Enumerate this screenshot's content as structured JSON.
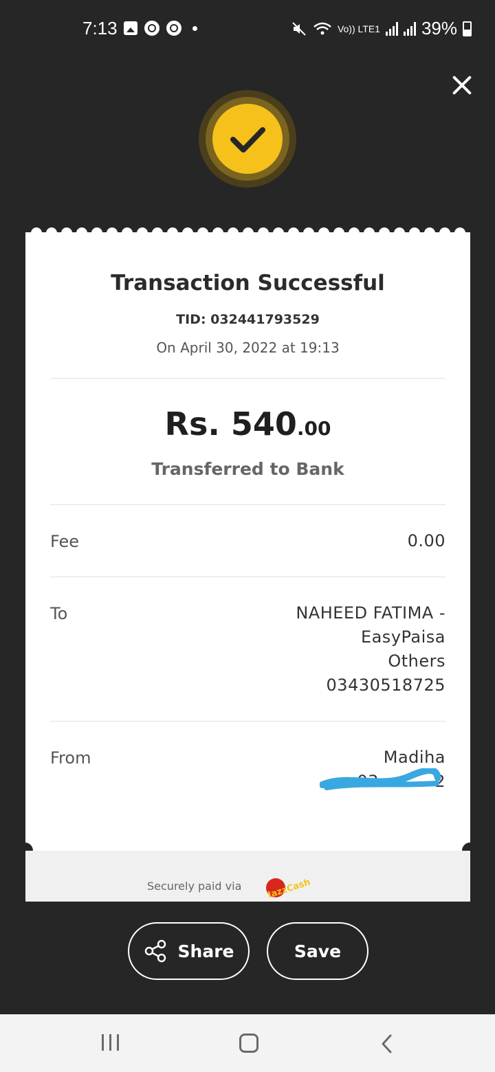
{
  "status_bar": {
    "time": "7:13",
    "network_label": "Vo)) LTE1",
    "battery": "39%",
    "icons": [
      "image-icon",
      "chrome-icon",
      "chrome-icon",
      "dot-icon",
      "mute-icon",
      "wifi-icon",
      "signal-icon",
      "signal-icon",
      "battery-icon"
    ]
  },
  "header": {
    "close_icon": "close-icon",
    "badge_icon": "check-icon",
    "badge_color": "#f6c11b"
  },
  "receipt": {
    "title": "Transaction Successful",
    "tid": "TID: 032441793529",
    "date": "On April 30, 2022 at 19:13",
    "amount_main": "Rs. 540",
    "amount_decimal": ".00",
    "subtitle": "Transferred to Bank",
    "rows": [
      {
        "label": "Fee",
        "lines": [
          "0.00"
        ]
      },
      {
        "label": "To",
        "lines": [
          "NAHEED FATIMA -",
          "EasyPaisa",
          "Others",
          "03430518725"
        ]
      },
      {
        "label": "From",
        "lines": [
          "Madiha",
          "03          2"
        ]
      }
    ],
    "footer_text": "Securely paid via",
    "footer_logo_text": "JazzCash"
  },
  "actions": {
    "share_label": "Share",
    "save_label": "Save"
  },
  "nav": {
    "icons": [
      "recent-apps-icon",
      "home-icon",
      "back-icon"
    ]
  }
}
